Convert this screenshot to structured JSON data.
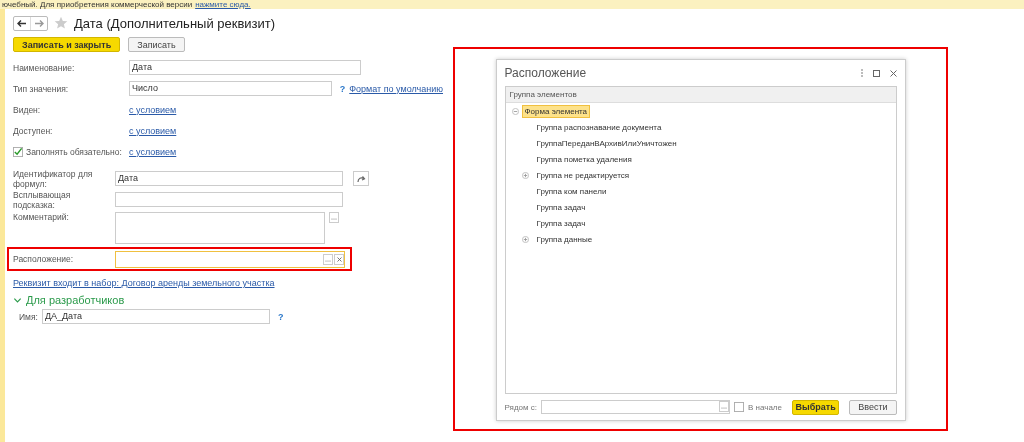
{
  "notice": {
    "text": "ючебный. Для приобретения коммерческой версии",
    "link": "нажмите сюда."
  },
  "header": {
    "title": "Дата (Дополнительный реквизит)",
    "favorite": false
  },
  "toolbar": [
    {
      "label": "Записать и закрыть",
      "kind": "primary"
    },
    {
      "label": "Записать",
      "kind": "default"
    }
  ],
  "main_fields": [
    {
      "kind": "input",
      "label": "Наименование:",
      "value": "Дата"
    },
    {
      "kind": "input",
      "label": "Тип значения:",
      "value": "Число",
      "help": "?",
      "link": "Формат по умолчанию"
    },
    {
      "kind": "link",
      "label": "Виден:",
      "link": "с условием"
    },
    {
      "kind": "link",
      "label": "Доступен:",
      "link": "с условием"
    },
    {
      "kind": "check_link",
      "label": "Заполнять обязательно:",
      "checked": true,
      "link": "с условием"
    }
  ],
  "extra_fields": [
    {
      "kind": "input_button",
      "label": "Идентификатор для формул:",
      "value": "Дата"
    },
    {
      "kind": "input",
      "label": "Всплывающая подсказка:"
    },
    {
      "kind": "textarea",
      "label": "Комментарий:"
    },
    {
      "kind": "choice",
      "label": "Расположение:",
      "highlighted": true
    }
  ],
  "set_link": "Реквизит входит в набор: Договор аренды земельного участка",
  "developers": {
    "title": "Для разработчиков",
    "expanded": true,
    "fields": [
      {
        "label": "Имя:",
        "value": "ДА_Дата",
        "help": "?"
      }
    ]
  },
  "dialog": {
    "title": "Расположение",
    "highlighted": true,
    "column": "Группа элементов",
    "tree": [
      {
        "label": "Форма элемента",
        "selected": true,
        "expanded": true,
        "children": [
          {
            "label": "Группа распознавание документа",
            "selected": false
          },
          {
            "label": "ГруппаПереданВАрхивИлиУничтожен",
            "selected": false
          },
          {
            "label": "Группа пометка удаления",
            "selected": false
          },
          {
            "label": "Группа не редактируется",
            "selected": false,
            "expanded": false
          },
          {
            "label": "Группа ком панели",
            "selected": false
          },
          {
            "label": "Группа задач",
            "selected": false
          },
          {
            "label": "Группа задач",
            "selected": false
          },
          {
            "label": "Группа данные",
            "selected": false,
            "expanded": false
          }
        ]
      }
    ],
    "footer": {
      "label": "Рядом с:",
      "checkbox": {
        "label": "В начале",
        "checked": false
      },
      "buttons": [
        {
          "label": "Выбрать",
          "kind": "primary"
        },
        {
          "label": "Ввести",
          "kind": "default"
        }
      ]
    }
  }
}
